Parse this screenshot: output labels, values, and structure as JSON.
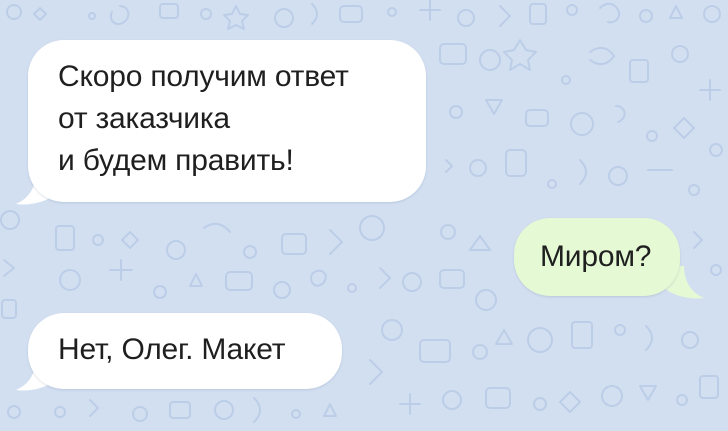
{
  "chat": {
    "colors": {
      "wallpaper": "#d2dff1",
      "wallpaper_doodle": "#b9cbe6",
      "incoming_bubble": "#ffffff",
      "outgoing_bubble": "#e5f9d5",
      "text": "#1f1f1f"
    },
    "messages": [
      {
        "direction": "incoming",
        "lines": [
          "Скоро получим ответ",
          "от заказчика",
          "и будем править!"
        ]
      },
      {
        "direction": "outgoing",
        "lines": [
          "Миром?"
        ]
      },
      {
        "direction": "incoming",
        "lines": [
          "Нет, Олег. Макет"
        ]
      }
    ]
  }
}
